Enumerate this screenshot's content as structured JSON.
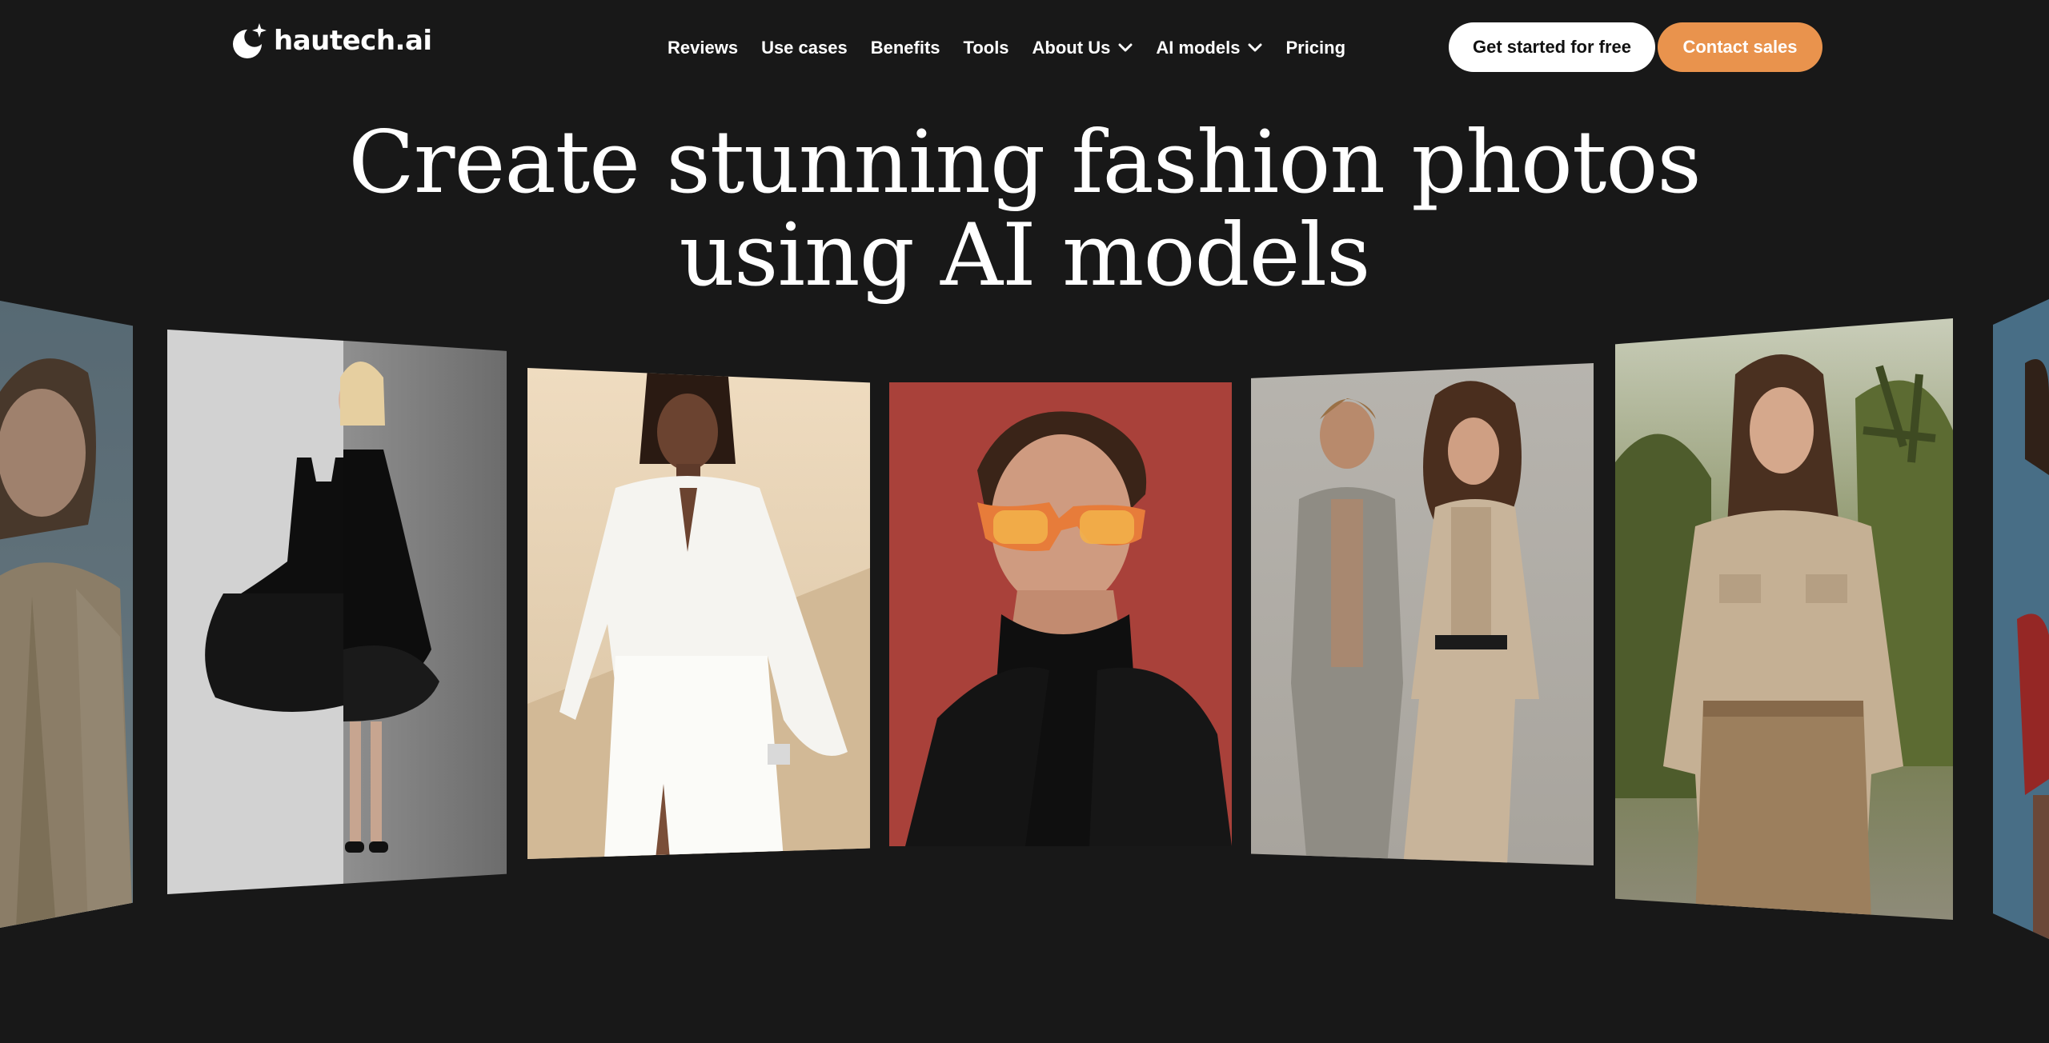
{
  "brand": {
    "name": "hautech.ai",
    "accent_color": "#e9934d",
    "background_color": "#181818"
  },
  "nav": {
    "items": [
      {
        "label": "Reviews",
        "has_dropdown": false
      },
      {
        "label": "Use cases",
        "has_dropdown": false
      },
      {
        "label": "Benefits",
        "has_dropdown": false
      },
      {
        "label": "Tools",
        "has_dropdown": false
      },
      {
        "label": "About Us",
        "has_dropdown": true
      },
      {
        "label": "AI models",
        "has_dropdown": true
      },
      {
        "label": "Pricing",
        "has_dropdown": false
      }
    ]
  },
  "header_buttons": {
    "get_started": "Get started for free",
    "contact_sales": "Contact sales"
  },
  "hero": {
    "title_line1": "Create stunning fashion photos",
    "title_line2": "using AI models"
  },
  "carousel": {
    "images": [
      {
        "subject": "woman-beige-blazer-blue-background"
      },
      {
        "subject": "black-tulle-dress-product-and-child-model"
      },
      {
        "subject": "woman-white-blouse-skirt-beige-background"
      },
      {
        "subject": "man-orange-glasses-black-turtleneck-red-background"
      },
      {
        "subject": "couple-neutral-suits-grey-background"
      },
      {
        "subject": "woman-beige-shirt-palm-garden"
      },
      {
        "subject": "woman-red-outfit-blue-background"
      }
    ]
  }
}
